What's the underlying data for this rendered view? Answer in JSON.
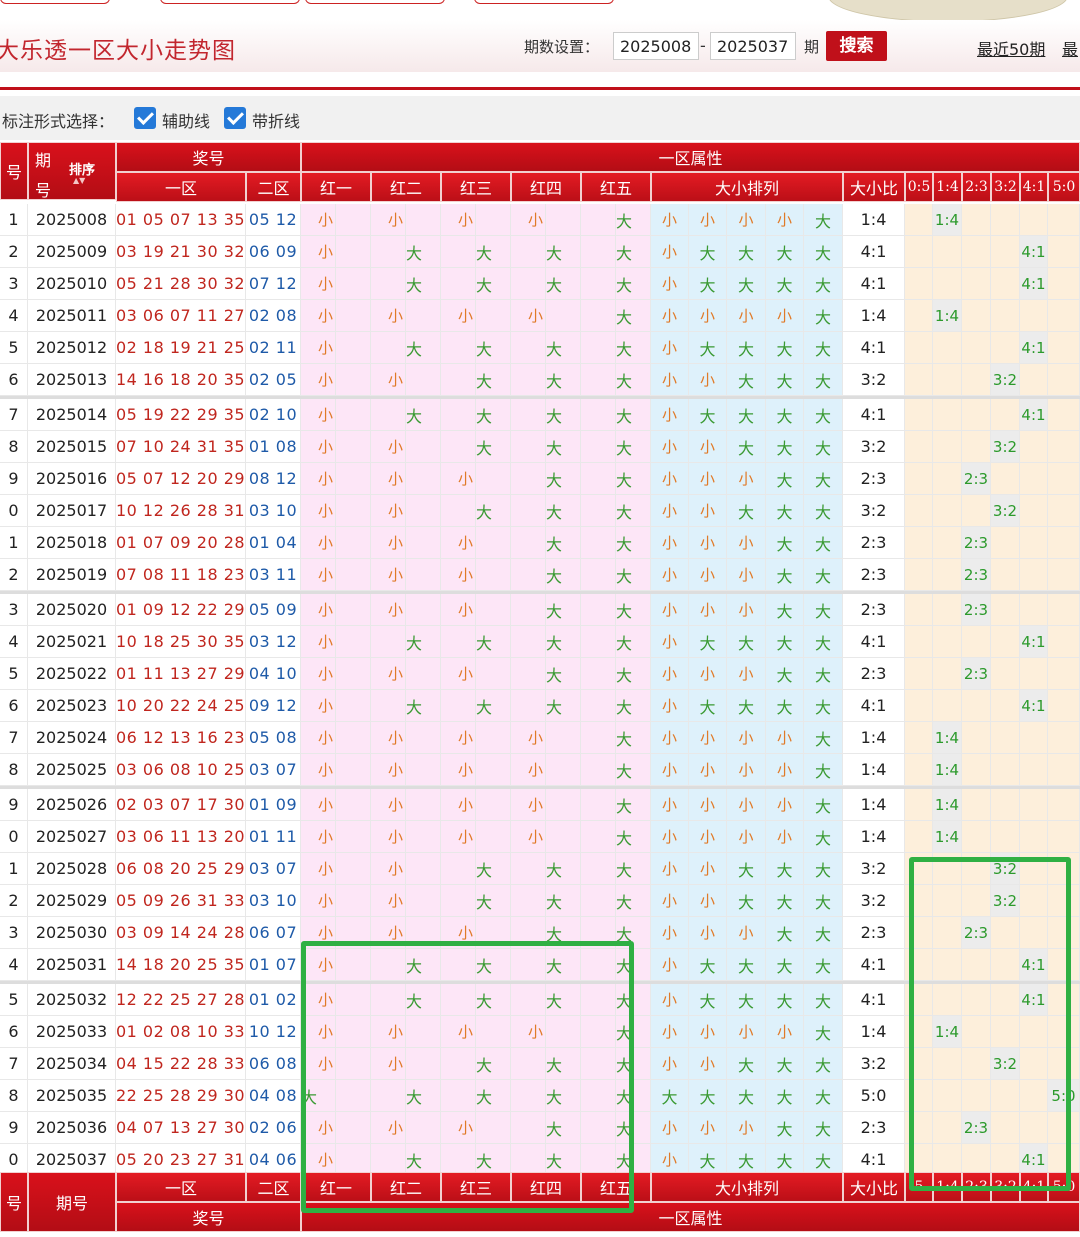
{
  "header": {
    "title": "大乐透一区大小走势图",
    "period_label": "期数设置：",
    "period_from": "2025008",
    "period_dash": "-",
    "period_to": "2025037",
    "period_unit": "期",
    "search_label": "搜索",
    "recent_link": "最近50期",
    "recent_link2": "最"
  },
  "options": {
    "label": "标注形式选择：",
    "assist_line_label": "辅助线",
    "polyline_label": "带折线"
  },
  "table": {
    "head": {
      "col_no": "号",
      "col_period_top": "期",
      "col_period_bottom": "号",
      "sort_label": "排序",
      "prize": "奖号",
      "zone1": "一区",
      "zone2": "二区",
      "attr": "一区属性",
      "reds": [
        "红一",
        "红二",
        "红三",
        "红四",
        "红五"
      ],
      "size_order": "大小排列",
      "ratio": "大小比",
      "ratios": [
        "0:5",
        "1:4",
        "2:3",
        "3:2",
        "4:1",
        "5:0"
      ]
    },
    "foot": {
      "col_no": "号",
      "col_period": "期号",
      "zone1": "一区",
      "zone2": "二区",
      "prize": "奖号",
      "attr": "一区属性",
      "reds": [
        "红一",
        "红二",
        "红三",
        "红四",
        "红五"
      ],
      "size_order": "大小排列",
      "ratio": "大小比",
      "ratios": [
        "5",
        "1:4",
        "2:3",
        "3:2",
        "4:1",
        "5:0"
      ]
    },
    "rows": [
      {
        "no": "1",
        "period": "2025008",
        "front": "01 05 07 13 35",
        "back": "05 12",
        "pattern": "小小小小大",
        "ratio": "1:4"
      },
      {
        "no": "2",
        "period": "2025009",
        "front": "03 19 21 30 32",
        "back": "06 09",
        "pattern": "小大大大大",
        "ratio": "4:1"
      },
      {
        "no": "3",
        "period": "2025010",
        "front": "05 21 28 30 32",
        "back": "07 12",
        "pattern": "小大大大大",
        "ratio": "4:1"
      },
      {
        "no": "4",
        "period": "2025011",
        "front": "03 06 07 11 27",
        "back": "02 08",
        "pattern": "小小小小大",
        "ratio": "1:4"
      },
      {
        "no": "5",
        "period": "2025012",
        "front": "02 18 19 21 25",
        "back": "02 11",
        "pattern": "小大大大大",
        "ratio": "4:1"
      },
      {
        "no": "6",
        "period": "2025013",
        "front": "14 16 18 20 35",
        "back": "02 05",
        "pattern": "小小大大大",
        "ratio": "3:2"
      },
      {
        "no": "7",
        "period": "2025014",
        "front": "05 19 22 29 35",
        "back": "02 10",
        "pattern": "小大大大大",
        "ratio": "4:1"
      },
      {
        "no": "8",
        "period": "2025015",
        "front": "07 10 24 31 35",
        "back": "01 08",
        "pattern": "小小大大大",
        "ratio": "3:2"
      },
      {
        "no": "9",
        "period": "2025016",
        "front": "05 07 12 20 29",
        "back": "08 12",
        "pattern": "小小小大大",
        "ratio": "2:3"
      },
      {
        "no": "0",
        "period": "2025017",
        "front": "10 12 26 28 31",
        "back": "03 10",
        "pattern": "小小大大大",
        "ratio": "3:2"
      },
      {
        "no": "1",
        "period": "2025018",
        "front": "01 07 09 20 28",
        "back": "01 04",
        "pattern": "小小小大大",
        "ratio": "2:3"
      },
      {
        "no": "2",
        "period": "2025019",
        "front": "07 08 11 18 23",
        "back": "03 11",
        "pattern": "小小小大大",
        "ratio": "2:3"
      },
      {
        "no": "3",
        "period": "2025020",
        "front": "01 09 12 22 29",
        "back": "05 09",
        "pattern": "小小小大大",
        "ratio": "2:3"
      },
      {
        "no": "4",
        "period": "2025021",
        "front": "10 18 25 30 35",
        "back": "03 12",
        "pattern": "小大大大大",
        "ratio": "4:1"
      },
      {
        "no": "5",
        "period": "2025022",
        "front": "01 11 13 27 29",
        "back": "04 10",
        "pattern": "小小小大大",
        "ratio": "2:3"
      },
      {
        "no": "6",
        "period": "2025023",
        "front": "10 20 22 24 25",
        "back": "09 12",
        "pattern": "小大大大大",
        "ratio": "4:1"
      },
      {
        "no": "7",
        "period": "2025024",
        "front": "06 12 13 16 23",
        "back": "05 08",
        "pattern": "小小小小大",
        "ratio": "1:4"
      },
      {
        "no": "8",
        "period": "2025025",
        "front": "03 06 08 10 25",
        "back": "03 07",
        "pattern": "小小小小大",
        "ratio": "1:4"
      },
      {
        "no": "9",
        "period": "2025026",
        "front": "02 03 07 17 30",
        "back": "01 09",
        "pattern": "小小小小大",
        "ratio": "1:4"
      },
      {
        "no": "0",
        "period": "2025027",
        "front": "03 06 11 13 20",
        "back": "01 11",
        "pattern": "小小小小大",
        "ratio": "1:4"
      },
      {
        "no": "1",
        "period": "2025028",
        "front": "06 08 20 25 29",
        "back": "03 07",
        "pattern": "小小大大大",
        "ratio": "3:2"
      },
      {
        "no": "2",
        "period": "2025029",
        "front": "05 09 26 31 33",
        "back": "03 10",
        "pattern": "小小大大大",
        "ratio": "3:2"
      },
      {
        "no": "3",
        "period": "2025030",
        "front": "03 09 14 24 28",
        "back": "06 07",
        "pattern": "小小小大大",
        "ratio": "2:3"
      },
      {
        "no": "4",
        "period": "2025031",
        "front": "14 18 20 25 35",
        "back": "01 07",
        "pattern": "小大大大大",
        "ratio": "4:1"
      },
      {
        "no": "5",
        "period": "2025032",
        "front": "12 22 25 27 28",
        "back": "01 02",
        "pattern": "小大大大大",
        "ratio": "4:1"
      },
      {
        "no": "6",
        "period": "2025033",
        "front": "01 02 08 10 33",
        "back": "10 12",
        "pattern": "小小小小大",
        "ratio": "1:4"
      },
      {
        "no": "7",
        "period": "2025034",
        "front": "04 15 22 28 33",
        "back": "06 08",
        "pattern": "小小大大大",
        "ratio": "3:2"
      },
      {
        "no": "8",
        "period": "2025035",
        "front": "22 25 28 29 30",
        "back": "04 08",
        "pattern": "大大大大大",
        "ratio": "5:0"
      },
      {
        "no": "9",
        "period": "2025036",
        "front": "04 07 13 27 30",
        "back": "02 06",
        "pattern": "小小小大大",
        "ratio": "2:3"
      },
      {
        "no": "0",
        "period": "2025037",
        "front": "05 20 23 27 31",
        "back": "04 06",
        "pattern": "小大大大大",
        "ratio": "4:1"
      }
    ]
  }
}
